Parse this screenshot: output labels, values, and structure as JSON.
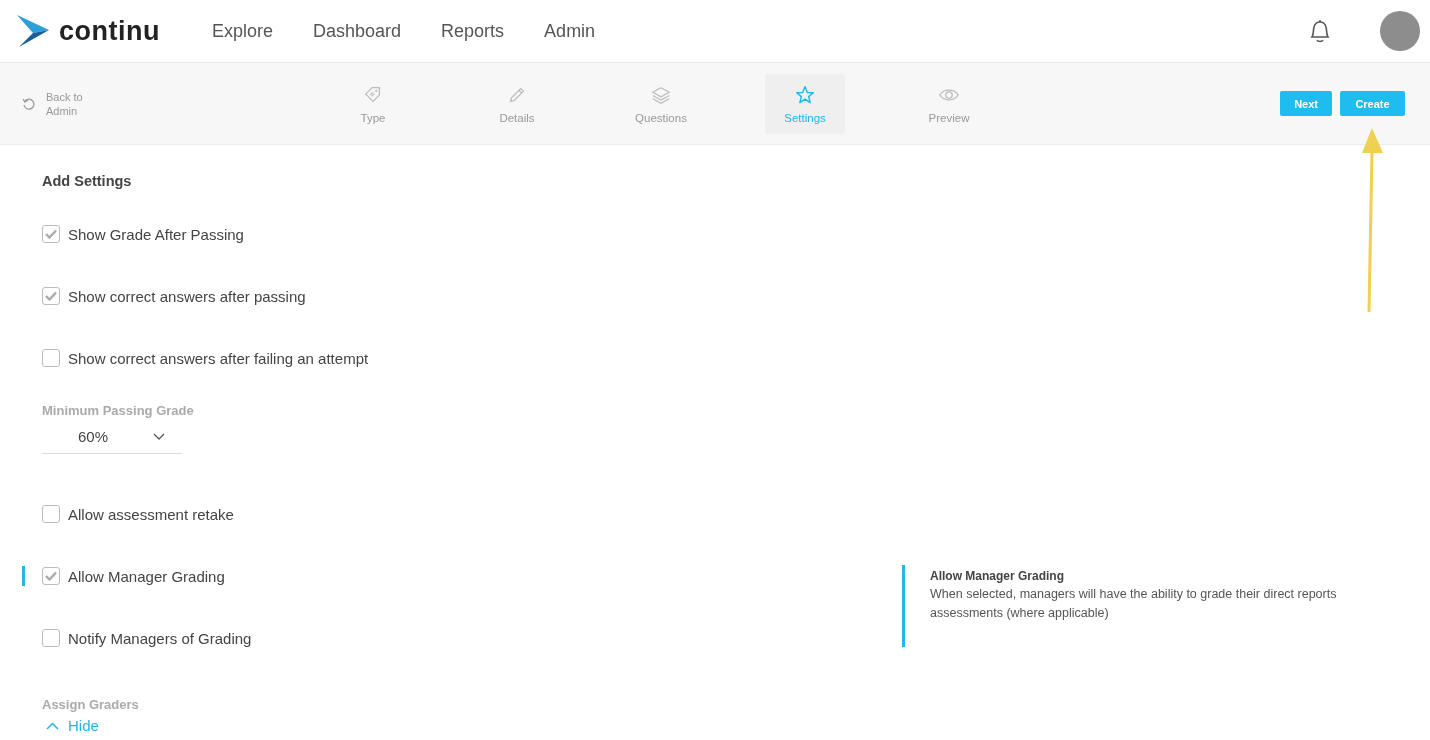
{
  "brand": {
    "name": "continu"
  },
  "nav": [
    {
      "label": "Explore"
    },
    {
      "label": "Dashboard"
    },
    {
      "label": "Reports"
    },
    {
      "label": "Admin"
    }
  ],
  "back": {
    "label": "Back to Admin"
  },
  "steps": [
    {
      "label": "Type",
      "selected": false
    },
    {
      "label": "Details",
      "selected": false
    },
    {
      "label": "Questions",
      "selected": false
    },
    {
      "label": "Settings",
      "selected": true
    },
    {
      "label": "Preview",
      "selected": false
    }
  ],
  "actions": [
    {
      "label": "Next"
    },
    {
      "label": "Create"
    }
  ],
  "settings": {
    "title": "Add Settings",
    "items": [
      {
        "kind": "checkbox",
        "label": "Show Grade After Passing",
        "checked": true,
        "focused": false
      },
      {
        "kind": "checkbox",
        "label": "Show correct answers after passing",
        "checked": true,
        "focused": false
      },
      {
        "kind": "checkbox",
        "label": "Show correct answers after failing an attempt",
        "checked": false,
        "focused": false
      },
      {
        "kind": "select",
        "label": "Minimum Passing Grade",
        "value": "60%"
      },
      {
        "kind": "checkbox",
        "label": "Allow assessment retake",
        "checked": false,
        "focused": false
      },
      {
        "kind": "checkbox",
        "label": "Allow Manager Grading",
        "checked": true,
        "focused": true
      },
      {
        "kind": "checkbox",
        "label": "Notify Managers of Grading",
        "checked": false,
        "focused": false
      },
      {
        "kind": "collapsible",
        "label": "Assign Graders",
        "toggle": "Hide",
        "expanded": true
      }
    ]
  },
  "help": {
    "title": "Allow Manager Grading",
    "text": "When selected, managers will have the ability to grade their direct reports assessments (where applicable)"
  }
}
